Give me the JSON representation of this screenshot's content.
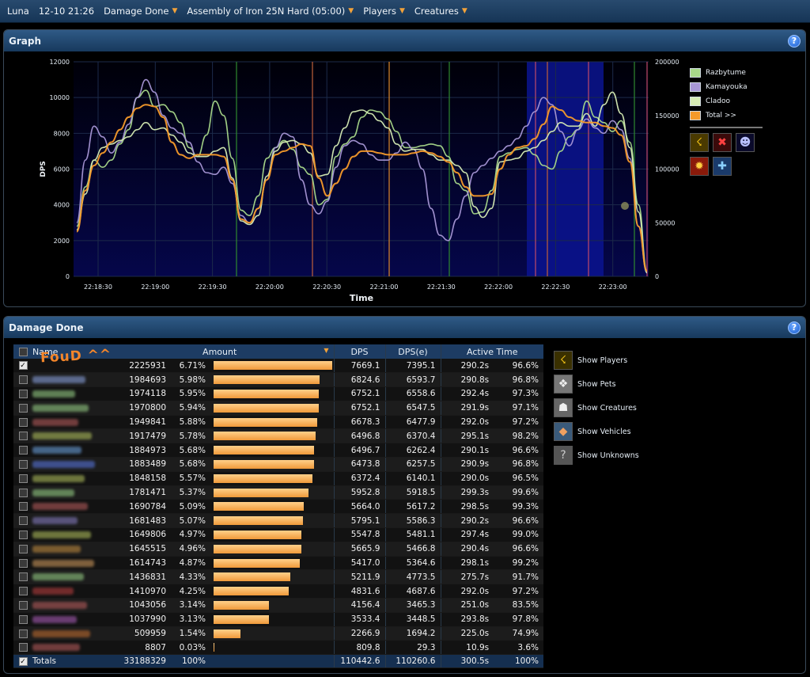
{
  "topbar": {
    "user": "Luna",
    "datetime": "12-10 21:26",
    "mode": "Damage Done",
    "encounter": "Assembly of Iron 25N Hard (05:00)",
    "players": "Players",
    "creatures": "Creatures"
  },
  "graph_panel": {
    "title": "Graph",
    "help": "?"
  },
  "damage_panel": {
    "title": "Damage Done",
    "help": "?"
  },
  "chart_data": {
    "type": "line",
    "xlabel": "Time",
    "ylabel": "DPS",
    "ylim": [
      0,
      12000
    ],
    "y2lim": [
      0,
      200000
    ],
    "yticks": [
      0,
      2000,
      4000,
      6000,
      8000,
      10000,
      12000
    ],
    "y2ticks": [
      0,
      50000,
      100000,
      150000,
      200000
    ],
    "xticks": [
      "22:18:30",
      "22:19:00",
      "22:19:30",
      "22:20:00",
      "22:20:30",
      "22:21:00",
      "22:21:30",
      "22:22:00",
      "22:22:30",
      "22:23:00"
    ],
    "grid": true,
    "legend_position": "right",
    "series": [
      {
        "name": "Razbytume",
        "color": "#a9d98a",
        "values": [
          2800,
          5000,
          6500,
          6100,
          6500,
          7400,
          8200,
          10000,
          10400,
          9500,
          9600,
          9200,
          8600,
          7200,
          6700,
          7900,
          9800,
          9000,
          6600,
          3700,
          3400,
          4500,
          6600,
          7200,
          7600,
          7100,
          6100,
          5700,
          4000,
          4300,
          6700,
          7400,
          7800,
          8900,
          9300,
          9200,
          8800,
          8100,
          7200,
          7200,
          7300,
          7400,
          7300,
          6700,
          5200,
          4800,
          3500,
          3600,
          4800,
          6700,
          6900,
          7100,
          7200,
          6800,
          6200,
          6000,
          7000,
          7800,
          8200,
          9800,
          8900,
          8600,
          8100,
          8700,
          7500,
          4000,
          300
        ]
      },
      {
        "name": "Kamayouka",
        "color": "#a897d6",
        "values": [
          3000,
          6500,
          8400,
          7800,
          6900,
          7500,
          8500,
          10000,
          11000,
          10300,
          9000,
          8300,
          8000,
          7500,
          6400,
          5800,
          5700,
          6100,
          5200,
          3400,
          3000,
          3800,
          5400,
          7200,
          8000,
          7800,
          5400,
          4000,
          3500,
          4200,
          6100,
          7300,
          7600,
          7400,
          6800,
          6500,
          6500,
          6900,
          7500,
          7100,
          6000,
          3800,
          2300,
          2000,
          3200,
          4500,
          5800,
          6200,
          6600,
          7000,
          7300,
          7700,
          8400,
          9200,
          10000,
          9600,
          8100,
          7300,
          8200,
          8800,
          8300,
          8000,
          8700,
          8200,
          6600,
          2800,
          200
        ]
      },
      {
        "name": "Cladoo",
        "color": "#d6ecb4",
        "values": [
          2600,
          4600,
          6500,
          7200,
          7400,
          7600,
          7800,
          8200,
          8600,
          8200,
          8300,
          7900,
          7500,
          6900,
          6700,
          6700,
          7000,
          7200,
          5500,
          3100,
          2900,
          3400,
          5600,
          7000,
          7500,
          7600,
          7400,
          6900,
          5600,
          5700,
          7300,
          8300,
          9200,
          9300,
          9100,
          8700,
          8300,
          7400,
          7000,
          7100,
          7100,
          6800,
          6500,
          6500,
          6200,
          5800,
          3900,
          3300,
          3800,
          6400,
          6500,
          6600,
          7000,
          7200,
          7600,
          8100,
          8600,
          8400,
          8400,
          9100,
          8400,
          9600,
          10300,
          9100,
          7200,
          3600,
          200
        ]
      },
      {
        "name": "Total >>",
        "color": "#f59a2a",
        "values": [
          2500,
          4800,
          6200,
          6900,
          7500,
          8200,
          8900,
          9400,
          9600,
          9500,
          8900,
          7500,
          6800,
          6600,
          6800,
          6800,
          6800,
          6700,
          5400,
          3200,
          3000,
          3800,
          5400,
          6800,
          7000,
          7200,
          7400,
          7300,
          5500,
          4500,
          5200,
          6000,
          6700,
          7000,
          7000,
          6900,
          6800,
          6800,
          6800,
          6900,
          7000,
          6900,
          6700,
          6400,
          5800,
          5000,
          4500,
          4500,
          4600,
          6000,
          6800,
          7200,
          7300,
          7700,
          8500,
          9500,
          9300,
          8900,
          8700,
          8600,
          8600,
          8400,
          8300,
          7900,
          6400,
          2800,
          300
        ]
      }
    ],
    "x_range_label": [
      "22:18:24",
      "22:23:09"
    ]
  },
  "legend": {
    "items": [
      {
        "label": "Razbytume",
        "color": "#a9d98a"
      },
      {
        "label": "Kamayouka",
        "color": "#a897d6"
      },
      {
        "label": "Cladoo",
        "color": "#d6ecb4"
      },
      {
        "label": "Total >>",
        "color": "#f59a2a"
      }
    ],
    "spell_icons": [
      "lightning-icon",
      "crossed-swords-icon",
      "skull-icon",
      "fire-icon",
      "cross-icon"
    ]
  },
  "table": {
    "headers": {
      "name": "Name",
      "amount": "Amount",
      "dps": "DPS",
      "dpse": "DPS(e)",
      "active": "Active Time"
    },
    "rows": [
      {
        "name": "Luna",
        "amount": "2225931",
        "pct": "6.71%",
        "bar": 1.0,
        "dps": "7669.1",
        "dpse": "7395.1",
        "time": "290.2s",
        "tpct": "96.6%",
        "checked": true,
        "color": "#ffffff"
      },
      {
        "amount": "1984693",
        "pct": "5.98%",
        "bar": 0.892,
        "dps": "6824.6",
        "dpse": "6593.7",
        "time": "290.8s",
        "tpct": "96.8%",
        "color": "#8fa8e8"
      },
      {
        "amount": "1974118",
        "pct": "5.95%",
        "bar": 0.887,
        "dps": "6752.1",
        "dpse": "6558.6",
        "time": "292.4s",
        "tpct": "97.3%",
        "color": "#9cd88a"
      },
      {
        "amount": "1970800",
        "pct": "5.94%",
        "bar": 0.885,
        "dps": "6752.1",
        "dpse": "6547.5",
        "time": "291.9s",
        "tpct": "97.1%",
        "color": "#9cd88a"
      },
      {
        "amount": "1949841",
        "pct": "5.88%",
        "bar": 0.876,
        "dps": "6678.3",
        "dpse": "6477.9",
        "time": "292.0s",
        "tpct": "97.2%",
        "color": "#c06060"
      },
      {
        "amount": "1917479",
        "pct": "5.78%",
        "bar": 0.861,
        "dps": "6496.8",
        "dpse": "6370.4",
        "time": "295.1s",
        "tpct": "98.2%",
        "color": "#b8c860"
      },
      {
        "amount": "1884973",
        "pct": "5.68%",
        "bar": 0.847,
        "dps": "6496.7",
        "dpse": "6262.4",
        "time": "290.1s",
        "tpct": "96.6%",
        "color": "#70a8e8"
      },
      {
        "amount": "1883489",
        "pct": "5.68%",
        "bar": 0.846,
        "dps": "6473.8",
        "dpse": "6257.5",
        "time": "290.9s",
        "tpct": "96.8%",
        "color": "#5a7ae8"
      },
      {
        "amount": "1848158",
        "pct": "5.57%",
        "bar": 0.83,
        "dps": "6372.4",
        "dpse": "6140.1",
        "time": "290.0s",
        "tpct": "96.5%",
        "color": "#b8c860"
      },
      {
        "amount": "1781471",
        "pct": "5.37%",
        "bar": 0.8,
        "dps": "5952.8",
        "dpse": "5918.5",
        "time": "299.3s",
        "tpct": "99.6%",
        "color": "#9cd88a"
      },
      {
        "amount": "1690784",
        "pct": "5.09%",
        "bar": 0.76,
        "dps": "5664.0",
        "dpse": "5617.2",
        "time": "298.5s",
        "tpct": "99.3%",
        "color": "#c06060"
      },
      {
        "amount": "1681483",
        "pct": "5.07%",
        "bar": 0.755,
        "dps": "5795.1",
        "dpse": "5586.3",
        "time": "290.2s",
        "tpct": "96.6%",
        "color": "#8a80c8"
      },
      {
        "amount": "1649806",
        "pct": "4.97%",
        "bar": 0.741,
        "dps": "5547.8",
        "dpse": "5481.1",
        "time": "297.4s",
        "tpct": "99.0%",
        "color": "#b8c860"
      },
      {
        "amount": "1645515",
        "pct": "4.96%",
        "bar": 0.739,
        "dps": "5665.9",
        "dpse": "5466.8",
        "time": "290.4s",
        "tpct": "96.6%",
        "color": "#c89040"
      },
      {
        "amount": "1614743",
        "pct": "4.87%",
        "bar": 0.725,
        "dps": "5417.0",
        "dpse": "5364.6",
        "time": "298.1s",
        "tpct": "99.2%",
        "color": "#d8a060"
      },
      {
        "amount": "1436831",
        "pct": "4.33%",
        "bar": 0.645,
        "dps": "5211.9",
        "dpse": "4773.5",
        "time": "275.7s",
        "tpct": "91.7%",
        "color": "#9cd88a"
      },
      {
        "amount": "1410970",
        "pct": "4.25%",
        "bar": 0.634,
        "dps": "4831.6",
        "dpse": "4687.6",
        "time": "292.0s",
        "tpct": "97.2%",
        "color": "#c04040"
      },
      {
        "amount": "1043056",
        "pct": "3.14%",
        "bar": 0.469,
        "dps": "4156.4",
        "dpse": "3465.3",
        "time": "251.0s",
        "tpct": "83.5%",
        "color": "#c06060"
      },
      {
        "amount": "1037990",
        "pct": "3.13%",
        "bar": 0.466,
        "dps": "3533.4",
        "dpse": "3448.5",
        "time": "293.8s",
        "tpct": "97.8%",
        "color": "#b060c0"
      },
      {
        "amount": "509959",
        "pct": "1.54%",
        "bar": 0.229,
        "dps": "2266.9",
        "dpse": "1694.2",
        "time": "225.0s",
        "tpct": "74.9%",
        "color": "#c87030"
      },
      {
        "amount": "8807",
        "pct": "0.03%",
        "bar": 0.004,
        "dps": "809.8",
        "dpse": "29.3",
        "time": "10.9s",
        "tpct": "3.6%",
        "color": "#c06060"
      }
    ],
    "totals": {
      "label": "Totals",
      "amount": "33188329",
      "pct": "100%",
      "dps": "110442.6",
      "dpse": "110260.6",
      "time": "300.5s",
      "tpct": "100%"
    }
  },
  "show_options": [
    {
      "label": "Show Players",
      "icon": "lightning-icon"
    },
    {
      "label": "Show Pets",
      "icon": "pet-icon"
    },
    {
      "label": "Show Creatures",
      "icon": "creature-icon"
    },
    {
      "label": "Show Vehicles",
      "icon": "vehicle-icon"
    },
    {
      "label": "Show Unknowns",
      "icon": "question-icon"
    }
  ],
  "annotation": "FouD ^^"
}
